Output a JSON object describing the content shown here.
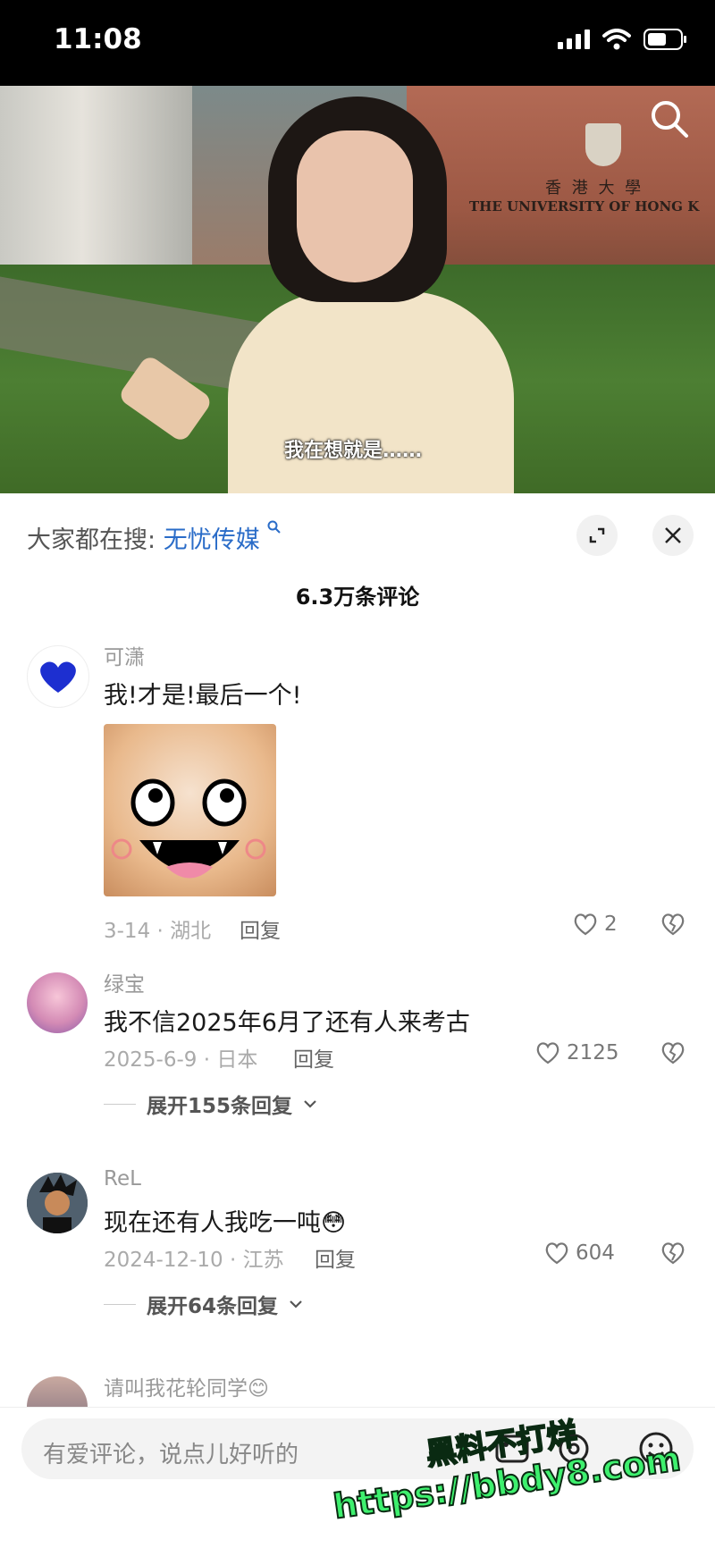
{
  "status_bar": {
    "time": "11:08"
  },
  "video": {
    "subtitle": "我在想就是……",
    "sign_cn": "香 港 大 學",
    "sign_en": "THE UNIVERSITY OF HONG K"
  },
  "sheet": {
    "hot_search_prefix": "大家都在搜:",
    "hot_search_keyword": "无忧传媒",
    "comment_count": "6.3万条评论"
  },
  "comments": [
    {
      "name": "可潇",
      "text": "我!才是!最后一个!",
      "date_loc": "3-14 · 湖北",
      "reply": "回复",
      "likes": "2"
    },
    {
      "name": "绿宝",
      "text": "我不信2025年6月了还有人来考古",
      "date_loc": "2025-6-9 · 日本",
      "reply": "回复",
      "likes": "2125",
      "expand": "展开155条回复"
    },
    {
      "name": "ReL",
      "text": "现在还有人我吃一吨",
      "emoji": "😳",
      "date_loc": "2024-12-10 · 江苏",
      "reply": "回复",
      "likes": "604",
      "expand": "展开64条回复"
    },
    {
      "name": "请叫我花轮同学",
      "emoji": "😊"
    }
  ],
  "input": {
    "placeholder": "有爱评论，说点儿好听的"
  },
  "watermark": {
    "line1": "黑料不打烊",
    "line2": "https://bbdy8.com"
  }
}
